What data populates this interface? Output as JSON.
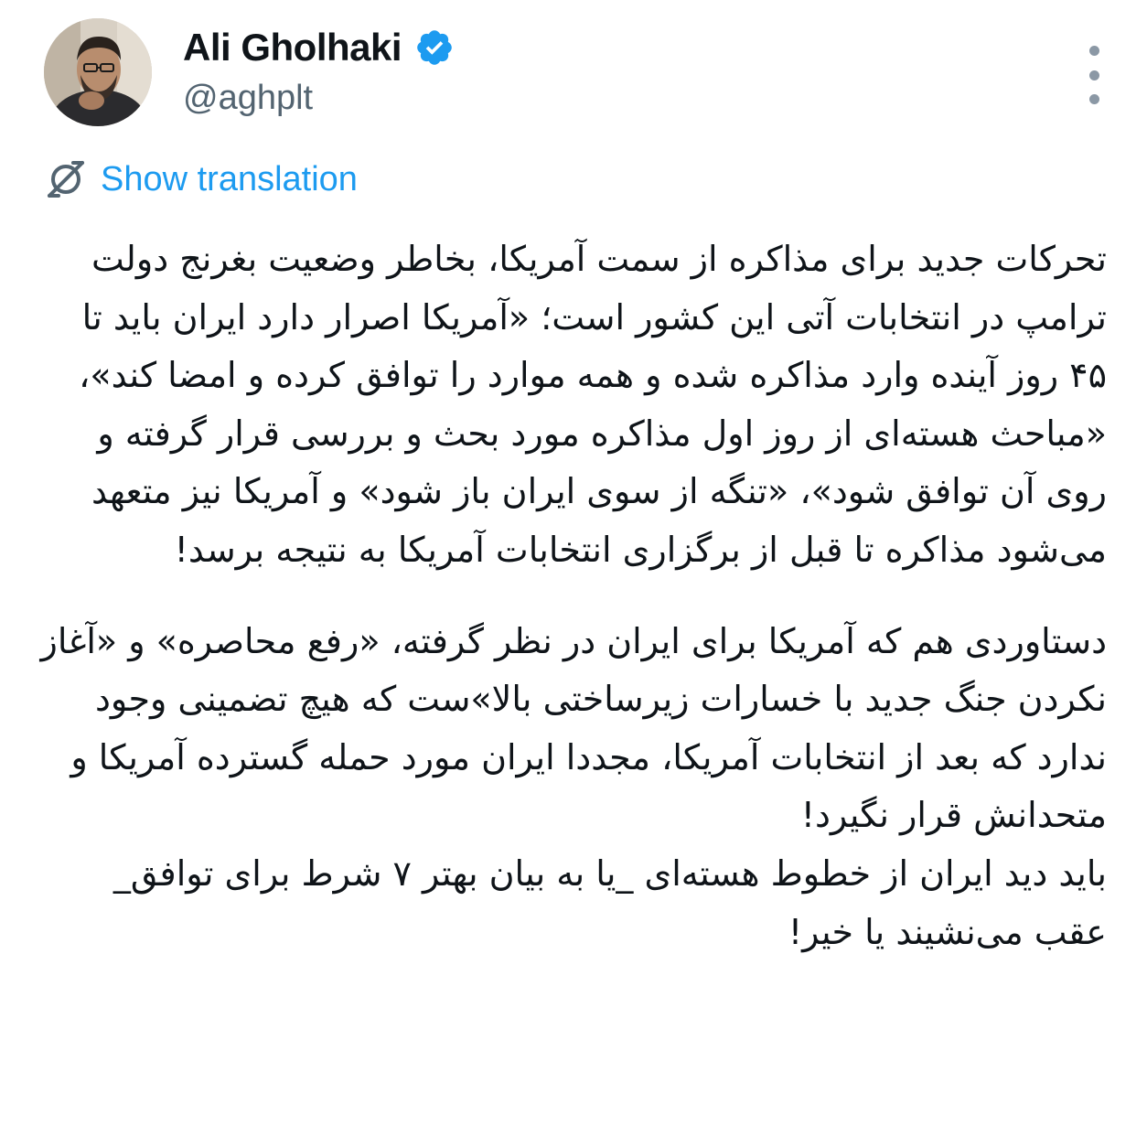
{
  "author": {
    "display_name": "Ali Gholhaki",
    "handle": "@aghplt",
    "verified": true,
    "avatar_icon": "profile-photo"
  },
  "actions": {
    "more_icon": "more-vertical-icon"
  },
  "translation": {
    "icon": "translate-icon",
    "label": "Show translation"
  },
  "tweet": {
    "paragraphs": [
      "تحرکات جدید برای مذاکره از سمت آمریکا، بخاطر وضعیت بغرنج دولت ترامپ در انتخابات آتی این کشور است؛ «آمریکا اصرار دارد ایران باید تا ۴۵ روز آینده وارد مذاکره شده و همه موارد را توافق کرده و امضا کند»، «مباحث هسته‌ای از روز اول مذاکره مورد بحث و بررسی قرار گرفته و روی آن توافق شود»، «تنگه از سوی ایران باز شود» و آمریکا نیز متعهد می‌شود مذاکره تا قبل از برگزاری انتخابات آمریکا به نتیجه برسد!",
      "دستاوردی هم که آمریکا برای ایران در نظر گرفته، «رفع محاصره» و «آغاز نکردن جنگ جدید با خسارات زیرساختی بالا»ست که هیچ تضمینی وجود ندارد که بعد از انتخابات آمریکا، مجددا ایران مورد حمله گسترده آمریکا و متحدانش قرار نگیرد!",
      "باید دید ایران از خطوط هسته‌ای _یا به بیان بهتر ۷ شرط برای توافق_ عقب می‌نشیند یا خیر!"
    ]
  },
  "colors": {
    "text": "#0f1419",
    "secondary": "#536471",
    "link": "#1d9bf0",
    "verified_badge": "#1d9bf0",
    "more_dots": "#8b98a5"
  }
}
